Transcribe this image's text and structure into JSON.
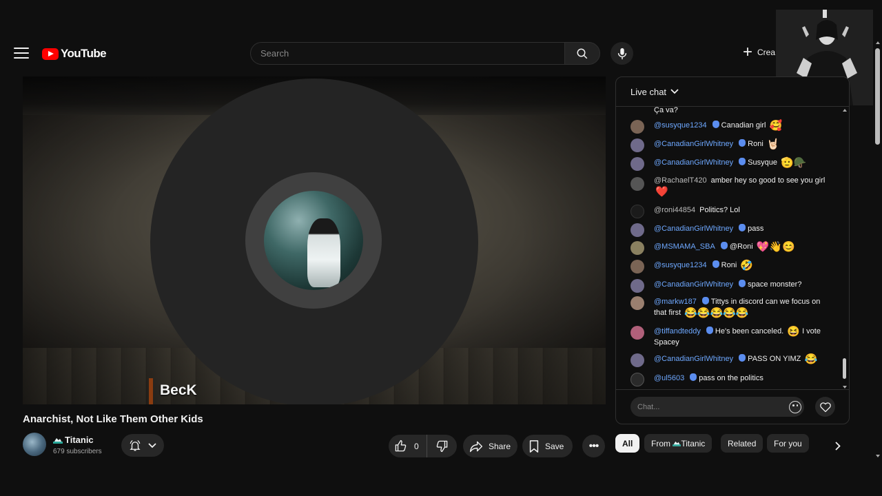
{
  "header": {
    "logo_text": "YouTube",
    "search_placeholder": "Search",
    "create_label": "Crea"
  },
  "player": {
    "overlay_name": "BecK"
  },
  "video": {
    "title": "Anarchist, Not Like Them Other Kids",
    "channel_name": "Titanic",
    "subscribers": "679 subscribers",
    "like_count": "0",
    "share_label": "Share",
    "save_label": "Save",
    "more_label": "•••"
  },
  "chat": {
    "header_label": "Live chat",
    "input_placeholder": "Chat...",
    "messages": [
      {
        "author": "",
        "text": "Ça va?",
        "emoji": ""
      },
      {
        "author": "@susyque1234",
        "text": "Canadian girl",
        "emoji": "🥰"
      },
      {
        "author": "@CanadianGirlWhitney",
        "text": "Roni",
        "emoji": "🤘🏻"
      },
      {
        "author": "@CanadianGirlWhitney",
        "text": "Susyque",
        "emoji": "🫡🪖"
      },
      {
        "author": "@RachaelT420",
        "text": "amber hey so good to see you girl",
        "emoji": "❤️"
      },
      {
        "author": "@roni44854",
        "text": "Politics? Lol",
        "emoji": ""
      },
      {
        "author": "@CanadianGirlWhitney",
        "text": "pass",
        "emoji": ""
      },
      {
        "author": "@MSMAMA_SBA",
        "text": "@Roni",
        "emoji": "💖👋😊"
      },
      {
        "author": "@susyque1234",
        "text": "Roni",
        "emoji": "🤣"
      },
      {
        "author": "@CanadianGirlWhitney",
        "text": "space monster?",
        "emoji": ""
      },
      {
        "author": "@markw187",
        "text": "Tittys in discord can we focus on that first",
        "emoji": "😂😂😂😂😂"
      },
      {
        "author": "@tiffandteddy",
        "text": "He's been canceled.",
        "emoji": "😆",
        "text_after": "I vote Spacey"
      },
      {
        "author": "@CanadianGirlWhitney",
        "text": "PASS ON YIMZ",
        "emoji": "😂"
      },
      {
        "author": "@ul5603",
        "text": "pass on the politics",
        "emoji": ""
      }
    ]
  },
  "chips": {
    "all": "All",
    "from_channel": "From",
    "from_channel_name": "Titanic",
    "related": "Related",
    "for_you": "For you"
  },
  "colors": {
    "background": "#0f0f0f",
    "accent_red": "#ff0000",
    "chat_author_blue": "#6ea8ff",
    "pill_bg": "#272727"
  }
}
